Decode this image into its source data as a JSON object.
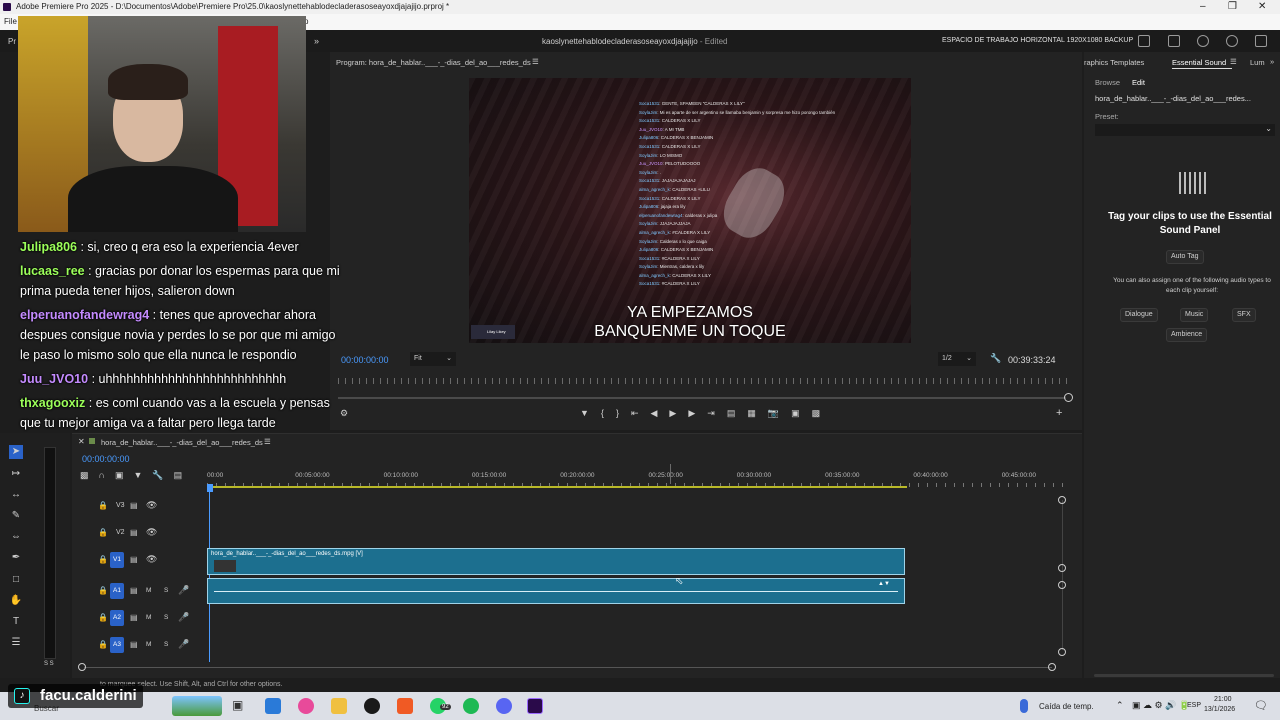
{
  "window": {
    "title": "Adobe Premiere Pro 2025 - D:\\Documentos\\Adobe\\Premiere Pro\\25.0\\kaoslynettehablodecladerasoseayoxdjajajijo.prproj *",
    "menu_first": "File",
    "menu_trailing": "p"
  },
  "appbar": {
    "project_name": "kaoslynettehablodecladerasoseayoxdjajajijo",
    "status": "- Edited",
    "workspace": "ESPACIO DE TRABAJO HORIZONTAL 1920X1080 BACKUP",
    "left_tab_fragment": "Pr"
  },
  "program_monitor": {
    "tab_label": "Program: hora_de_hablar..___-_-dias_del_ao___redes_ds",
    "timecode": "00:00:00:00",
    "fit": "Fit",
    "resolution": "1/2",
    "duration": "00:39:33:24",
    "subtitle_line1": "YA EMPEZAMOS",
    "subtitle_line2": "BANQUENME UN TOQUE",
    "ingame_chat": [
      {
        "u": "Soca1531",
        "m": ": GENTE, SPAMEEN \"CALDERAS X LILY\""
      },
      {
        "u": "SoylaJim",
        "m": ": Mi es aparte de ser argentino se llamaba benjamin y sorpresa me hizo porongo también"
      },
      {
        "u": "Soca1531",
        "m": ": CALDERAS X LILY"
      },
      {
        "u": "Juu_JVO10",
        "m": ": A MI TMB"
      },
      {
        "u": "Julipa806",
        "m": ": CALDERAS X BENJAMIN"
      },
      {
        "u": "Soca1531",
        "m": ": CALDERAS X LILY"
      },
      {
        "u": "SoylaJim",
        "m": ": LO MISMO"
      },
      {
        "u": "Juu_JVO10",
        "m": ": PELOTUDOOOO"
      },
      {
        "u": "SoylaJim",
        "m": ": ."
      },
      {
        "u": "Soca1531",
        "m": ": JAJAJAJAJAJAJ"
      },
      {
        "u": "alma_agrech_k",
        "m": ": CALDERAS +LILU"
      },
      {
        "u": "Soca1531",
        "m": ": CALDERAS X LILY"
      },
      {
        "u": "Julipa806",
        "m": ": jajaja era lily"
      },
      {
        "u": "elperuanofandewrag4",
        "m": ": calderas x julipa"
      },
      {
        "u": "SoylaJim",
        "m": ": JJAJAJAJJAJA"
      },
      {
        "u": "alma_agrech_k",
        "m": ": #CALDERA X LILY"
      },
      {
        "u": "SoylaJim",
        "m": ": Calderas x lo que caiga"
      },
      {
        "u": "Julipa806",
        "m": ": CALDERAS X BENJAMIN"
      },
      {
        "u": "Soca1531",
        "m": ": #CALDERA X LILY"
      },
      {
        "u": "SoylaJim",
        "m": ": Mientras, caldera x lily"
      },
      {
        "u": "alma_agrech_k",
        "m": ": CALDERAS X LILY"
      },
      {
        "u": "Soca1531",
        "m": ": #CALDERA X LILY"
      }
    ],
    "corner_tag": "Lilay Likey"
  },
  "right_panel": {
    "tab_left": "raphics Templates",
    "tab_active": "Essential Sound",
    "tab_right": "Lum",
    "sub_browse": "Browse",
    "sub_edit": "Edit",
    "clip_name": "hora_de_hablar..___-_-dias_del_ao___redes...",
    "preset_label": "Preset:",
    "headline": "Tag your clips to use the Essential Sound Panel",
    "auto_tag": "Auto Tag",
    "assign_text": "You can also assign one of the following audio types to each clip yourself:",
    "types": [
      "Dialogue",
      "Music",
      "SFX",
      "Ambience"
    ]
  },
  "overlay_chat": [
    {
      "name": "Julipa806",
      "color": "#9cff5a",
      "text": ": si, creo q era eso la experiencia 4ever"
    },
    {
      "name": "lucaas_ree",
      "color": "#9cff5a",
      "text": ": gracias por donar los espermas para que mi prima pueda tener hijos, salieron down"
    },
    {
      "name": "elperuanofandewrag4",
      "color": "#c48bff",
      "text": ": tenes que aprovechar ahora despues consigue novia y perdes lo se por que mi amigo le paso lo mismo solo que ella nunca le respondio"
    },
    {
      "name": "Juu_JVO10",
      "color": "#c48bff",
      "text": ": uhhhhhhhhhhhhhhhhhhhhhhhhhh"
    },
    {
      "name": "thxagooxiz",
      "color": "#9cff5a",
      "text": ": es coml cuando vas a la escuela y pensas que tu mejor amiga va a faltar pero llega tarde"
    }
  ],
  "timeline": {
    "sequence_tab": "hora_de_hablar..___-_-dias_del_ao___redes_ds",
    "timecode": "00:00:00:00",
    "ruler": [
      "00:00",
      "00:05:00:00",
      "00:10:00:00",
      "00:15:00:00",
      "00:20:00:00",
      "00:25:00:00",
      "00:30:00:00",
      "00:35:00:00",
      "00:40:00:00",
      "00:45:00:00"
    ],
    "video_tracks": [
      "V3",
      "V2",
      "V1"
    ],
    "audio_tracks": [
      "A1",
      "A2",
      "A3"
    ],
    "video_clip_name": "hora_de_hablar..___-_-dias_del_ao___redes_ds.mpg [V]",
    "track_mute": "M",
    "track_solo": "S",
    "meter_label": "S S"
  },
  "status_bar": "to marquee select. Use Shift, Alt, and Ctrl for other options.",
  "taskbar": {
    "watermark": "facu.calderini",
    "search_fragment": "Buscar",
    "whatsapp_badge": "92",
    "weather": "Caída de temp.",
    "lang": "ESP",
    "time": "21:00",
    "date": "13/1/2026"
  },
  "colors": {
    "accent_blue": "#2a62c8",
    "clip_teal": "#1c6f8f",
    "timecode_blue": "#4a9bff"
  }
}
